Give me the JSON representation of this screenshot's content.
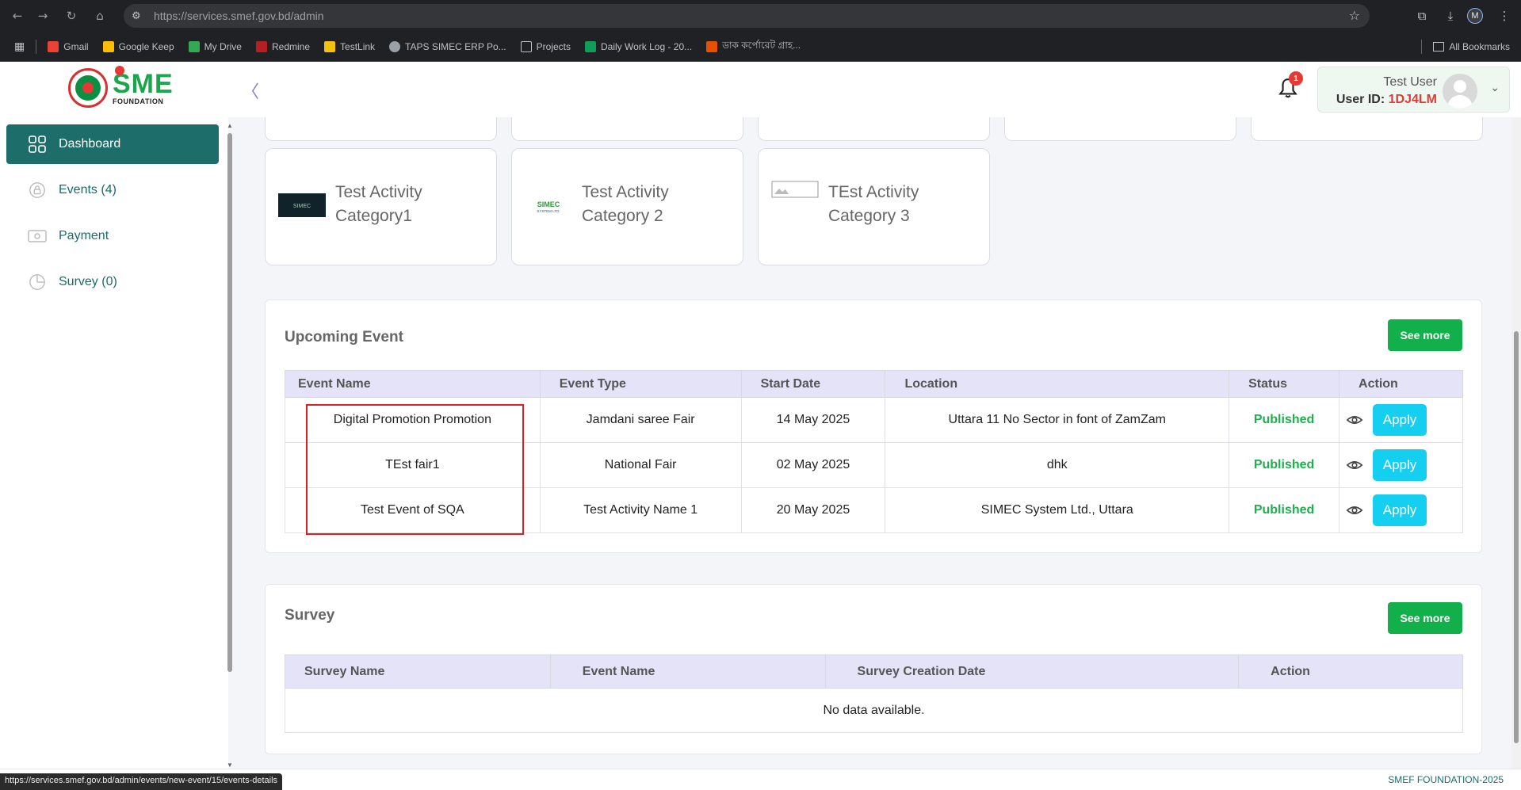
{
  "browser": {
    "url_host": "https://services.smef.gov.bd",
    "url_path": "/admin",
    "profile_initial": "M",
    "status_url": "https://services.smef.gov.bd/admin/events/new-event/15/events-details",
    "bookmarks": [
      {
        "label": "Gmail",
        "color": "#ea4335"
      },
      {
        "label": "Google Keep",
        "color": "#fbbc04"
      },
      {
        "label": "My Drive",
        "color": "#34a853"
      },
      {
        "label": "Redmine",
        "color": "#b32024"
      },
      {
        "label": "TestLink",
        "color": "#f4c20d"
      },
      {
        "label": "TAPS SIMEC ERP Po...",
        "color": "#9aa0a6"
      },
      {
        "label": "Projects",
        "color": "#9aa0a6"
      },
      {
        "label": "Daily Work Log - 20...",
        "color": "#0f9d58"
      },
      {
        "label": "ডাক কর্পোরেট গ্রাহ...",
        "color": "#e65100"
      }
    ],
    "all_bookmarks": "All Bookmarks"
  },
  "header": {
    "brand": "SME",
    "brand_sub": "FOUNDATION",
    "notification_count": "1",
    "user_name": "Test User",
    "user_id_label": "User ID:",
    "user_id_value": "1DJ4LM"
  },
  "sidebar": {
    "items": [
      {
        "label": "Dashboard",
        "icon": "grid-icon",
        "active": true
      },
      {
        "label": "Events (4)",
        "icon": "lock-icon",
        "active": false
      },
      {
        "label": "Payment",
        "icon": "payment-icon",
        "active": false
      },
      {
        "label": "Survey (0)",
        "icon": "pie-icon",
        "active": false
      }
    ]
  },
  "categories": [
    {
      "name": "Test Activity Category1",
      "thumb": "SIMEC"
    },
    {
      "name": "Test Activity Category 2",
      "thumb": "SIMEC SYSTEM LTD."
    },
    {
      "name": "TEst Activity Category 3",
      "thumb": ""
    }
  ],
  "upcoming": {
    "title": "Upcoming Event",
    "see_more": "See more",
    "columns": [
      "Event Name",
      "Event Type",
      "Start Date",
      "Location",
      "Status",
      "Action"
    ],
    "rows": [
      {
        "name": "Digital Promotion Promotion",
        "type": "Jamdani saree Fair",
        "date": "14 May 2025",
        "location": "Uttara 11 No Sector in font of ZamZam",
        "status": "Published",
        "action": "Apply"
      },
      {
        "name": "TEst fair1",
        "type": "National Fair",
        "date": "02 May 2025",
        "location": "dhk",
        "status": "Published",
        "action": "Apply"
      },
      {
        "name": "Test Event of SQA",
        "type": "Test Activity Name 1",
        "date": "20 May 2025",
        "location": "SIMEC System Ltd., Uttara",
        "status": "Published",
        "action": "Apply"
      }
    ]
  },
  "survey": {
    "title": "Survey",
    "see_more": "See more",
    "columns": [
      "Survey Name",
      "Event Name",
      "Survey Creation Date",
      "Action"
    ],
    "empty": "No data available."
  },
  "footer": {
    "copyright": "SMEF FOUNDATION-2025"
  },
  "colors": {
    "primary": "#1d6e6a",
    "success": "#12b04a",
    "apply": "#14cff0",
    "header_table": "#e4e3f7",
    "alert": "#e53935"
  }
}
